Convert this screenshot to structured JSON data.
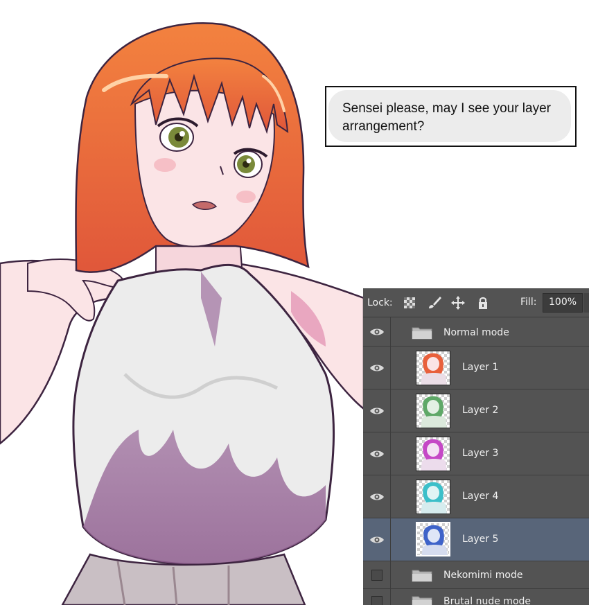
{
  "speech_bubble": {
    "text": "Sensei please, may I see your layer arrangement?"
  },
  "layers_panel": {
    "lock_label": "Lock:",
    "fill_label": "Fill:",
    "fill_value": "100%",
    "lock_icons": [
      "lock-transparent-pixels-icon",
      "lock-image-pixels-icon",
      "lock-position-icon",
      "lock-all-icon"
    ],
    "groups": [
      {
        "name": "Normal mode",
        "expanded": true,
        "visible": true
      },
      {
        "name": "Nekomimi mode",
        "expanded": false,
        "visible": false
      },
      {
        "name": "Brutal nude mode",
        "expanded": false,
        "visible": false
      }
    ],
    "layers": [
      {
        "name": "Layer 1",
        "visible": true,
        "selected": false,
        "hair_color": "#e8603c"
      },
      {
        "name": "Layer 2",
        "visible": true,
        "selected": false,
        "hair_color": "#5fa868"
      },
      {
        "name": "Layer 3",
        "visible": true,
        "selected": false,
        "hair_color": "#c548c6"
      },
      {
        "name": "Layer 4",
        "visible": true,
        "selected": false,
        "hair_color": "#3cbfc9"
      },
      {
        "name": "Layer 5",
        "visible": true,
        "selected": true,
        "hair_color": "#3e63c9"
      }
    ]
  },
  "colors": {
    "panel_bg": "#535353",
    "selected_row": "#586579",
    "hair": "#f0703c"
  }
}
